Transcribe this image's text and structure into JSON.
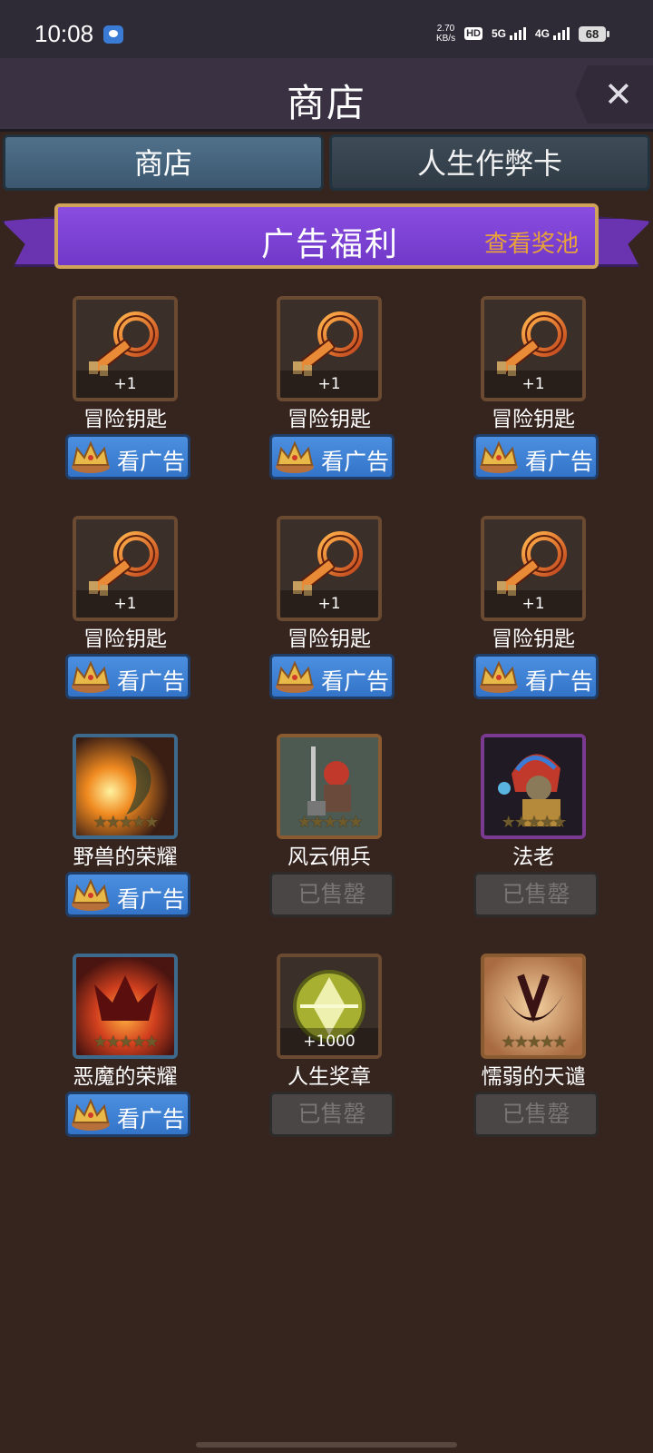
{
  "status_bar": {
    "time": "10:08",
    "net_speed_value": "2.70",
    "net_speed_unit": "KB/s",
    "hd": "HD",
    "sim1_label": "5G",
    "sim2_label": "4G",
    "battery": "68"
  },
  "header": {
    "title": "商店",
    "close_icon": "close-icon"
  },
  "tabs": [
    {
      "label": "商店",
      "selected": true
    },
    {
      "label": "人生作弊卡",
      "selected": false
    }
  ],
  "banner": {
    "title": "广告福利",
    "pool_link": "查看奖池",
    "accent": "#7038c8",
    "link_color": "#e8a23a"
  },
  "items": [
    {
      "name": "冒险钥匙",
      "qty": "+1",
      "icon": "key-icon",
      "action": "看广告",
      "sold": false
    },
    {
      "name": "冒险钥匙",
      "qty": "+1",
      "icon": "key-icon",
      "action": "看广告",
      "sold": false
    },
    {
      "name": "冒险钥匙",
      "qty": "+1",
      "icon": "key-icon",
      "action": "看广告",
      "sold": false
    },
    {
      "name": "冒险钥匙",
      "qty": "+1",
      "icon": "key-icon",
      "action": "看广告",
      "sold": false
    },
    {
      "name": "冒险钥匙",
      "qty": "+1",
      "icon": "key-icon",
      "action": "看广告",
      "sold": false
    },
    {
      "name": "冒险钥匙",
      "qty": "+1",
      "icon": "key-icon",
      "action": "看广告",
      "sold": false
    },
    {
      "name": "野兽的荣耀",
      "qty": "",
      "icon": "beast-glory-icon",
      "action": "看广告",
      "sold": false
    },
    {
      "name": "风云佣兵",
      "qty": "",
      "icon": "mercenary-icon",
      "action": "已售罄",
      "sold": true
    },
    {
      "name": "法老",
      "qty": "",
      "icon": "pharaoh-icon",
      "action": "已售罄",
      "sold": true
    },
    {
      "name": "恶魔的荣耀",
      "qty": "",
      "icon": "demon-glory-icon",
      "action": "看广告",
      "sold": false
    },
    {
      "name": "人生奖章",
      "qty": "+1000",
      "icon": "life-medal-icon",
      "action": "已售罄",
      "sold": true
    },
    {
      "name": "懦弱的天谴",
      "qty": "",
      "icon": "coward-wrath-icon",
      "action": "已售罄",
      "sold": true
    }
  ]
}
